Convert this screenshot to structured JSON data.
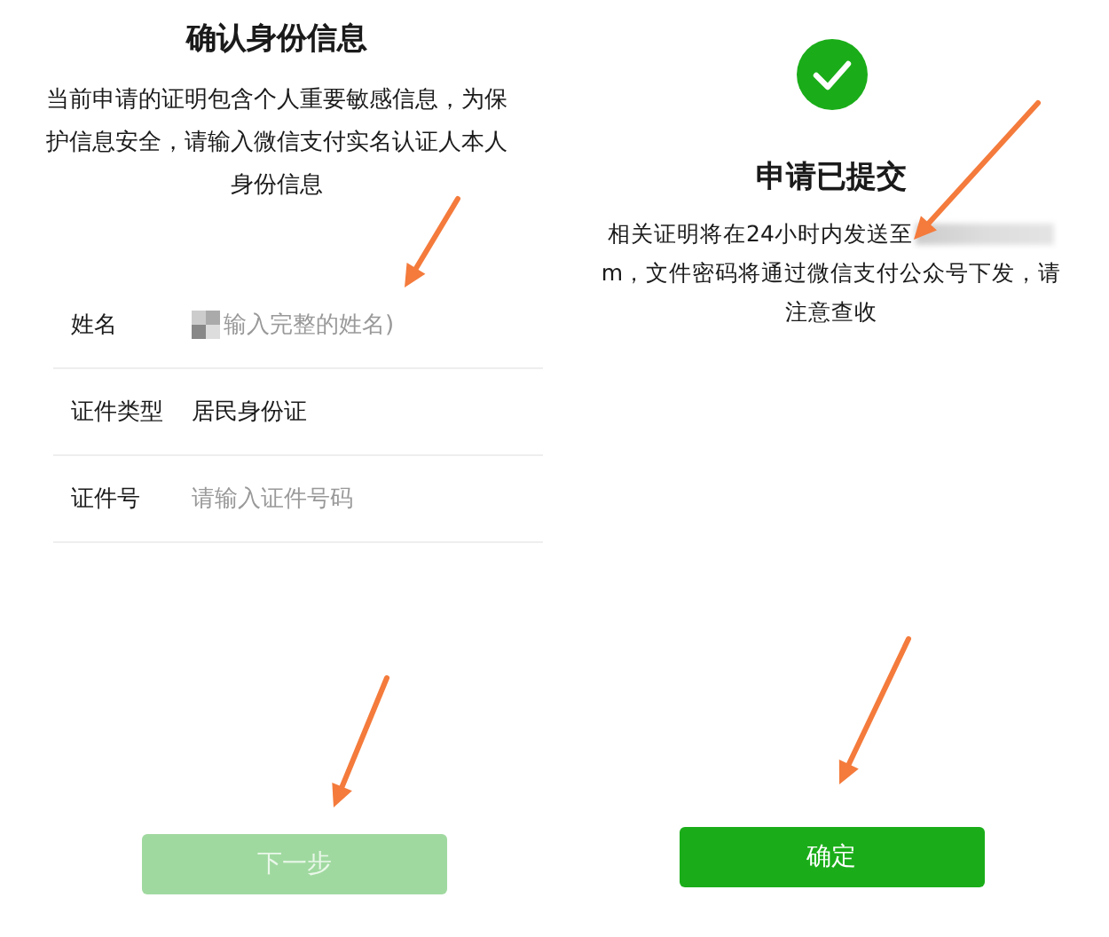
{
  "left_screen": {
    "title": "确认身份信息",
    "notice": "当前申请的证明包含个人重要敏感信息，为保护信息安全，请输入微信支付实名认证人本人身份信息",
    "fields": [
      {
        "label": "姓名",
        "kind": "masked",
        "placeholder": "输入完整的姓名)"
      },
      {
        "label": "证件类型",
        "kind": "value",
        "value": "居民身份证"
      },
      {
        "label": "证件号",
        "kind": "input",
        "placeholder": "请输入证件号码"
      }
    ],
    "button": {
      "label": "下一步",
      "disabled": true
    }
  },
  "right_screen": {
    "title": "申请已提交",
    "message_start": "相关证明将在24小时内发送至",
    "message_rest": "m，文件密码将通过微信支付公众号下发，请注意查收",
    "button": {
      "label": "确定",
      "disabled": false
    }
  }
}
